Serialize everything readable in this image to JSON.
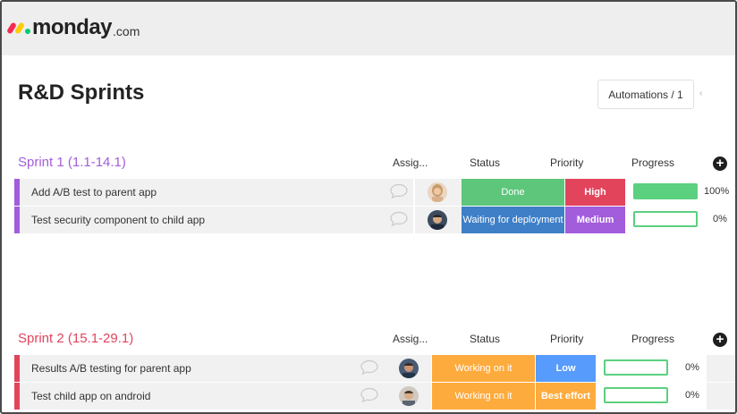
{
  "app": {
    "logo_word": "monday",
    "logo_suffix": ".com"
  },
  "board": {
    "title": "R&D Sprints",
    "automations_label": "Automations / 1",
    "automations_extra": "‹"
  },
  "columns": {
    "assignee": "Assig...",
    "status": "Status",
    "priority": "Priority",
    "progress": "Progress"
  },
  "colors": {
    "done": "#5ec67a",
    "working": "#fdab3d",
    "waiting": "#3f7fc7",
    "high": "#e2445c",
    "medium": "#a25ddc",
    "low": "#579bfc",
    "best_effort": "#fdab3d",
    "sprint1": "#a25ddc",
    "sprint2": "#e2445c"
  },
  "groups": [
    {
      "title": "Sprint 1 (1.1-14.1)",
      "color": "#a25ddc",
      "rows": [
        {
          "name": "Add A/B test to parent app",
          "status": "Done",
          "priority": "High",
          "progress": "100%",
          "progress_value": 100,
          "avatar": "avatar-woman"
        },
        {
          "name": "Test security component to child app",
          "status": "Waiting for deployment",
          "priority": "Medium",
          "progress": "0%",
          "progress_value": 0,
          "avatar": "avatar-man-1"
        }
      ]
    },
    {
      "title": "Sprint 2 (15.1-29.1)",
      "color": "#e2445c",
      "rows": [
        {
          "name": "Results A/B testing for parent app",
          "status": "Working on it",
          "priority": "Low",
          "progress": "0%",
          "progress_value": 0,
          "avatar": "avatar-man-2"
        },
        {
          "name": "Test child app on android",
          "status": "Working on it",
          "priority": "Best effort",
          "progress": "0%",
          "progress_value": 0,
          "avatar": "avatar-man-3"
        }
      ]
    }
  ]
}
